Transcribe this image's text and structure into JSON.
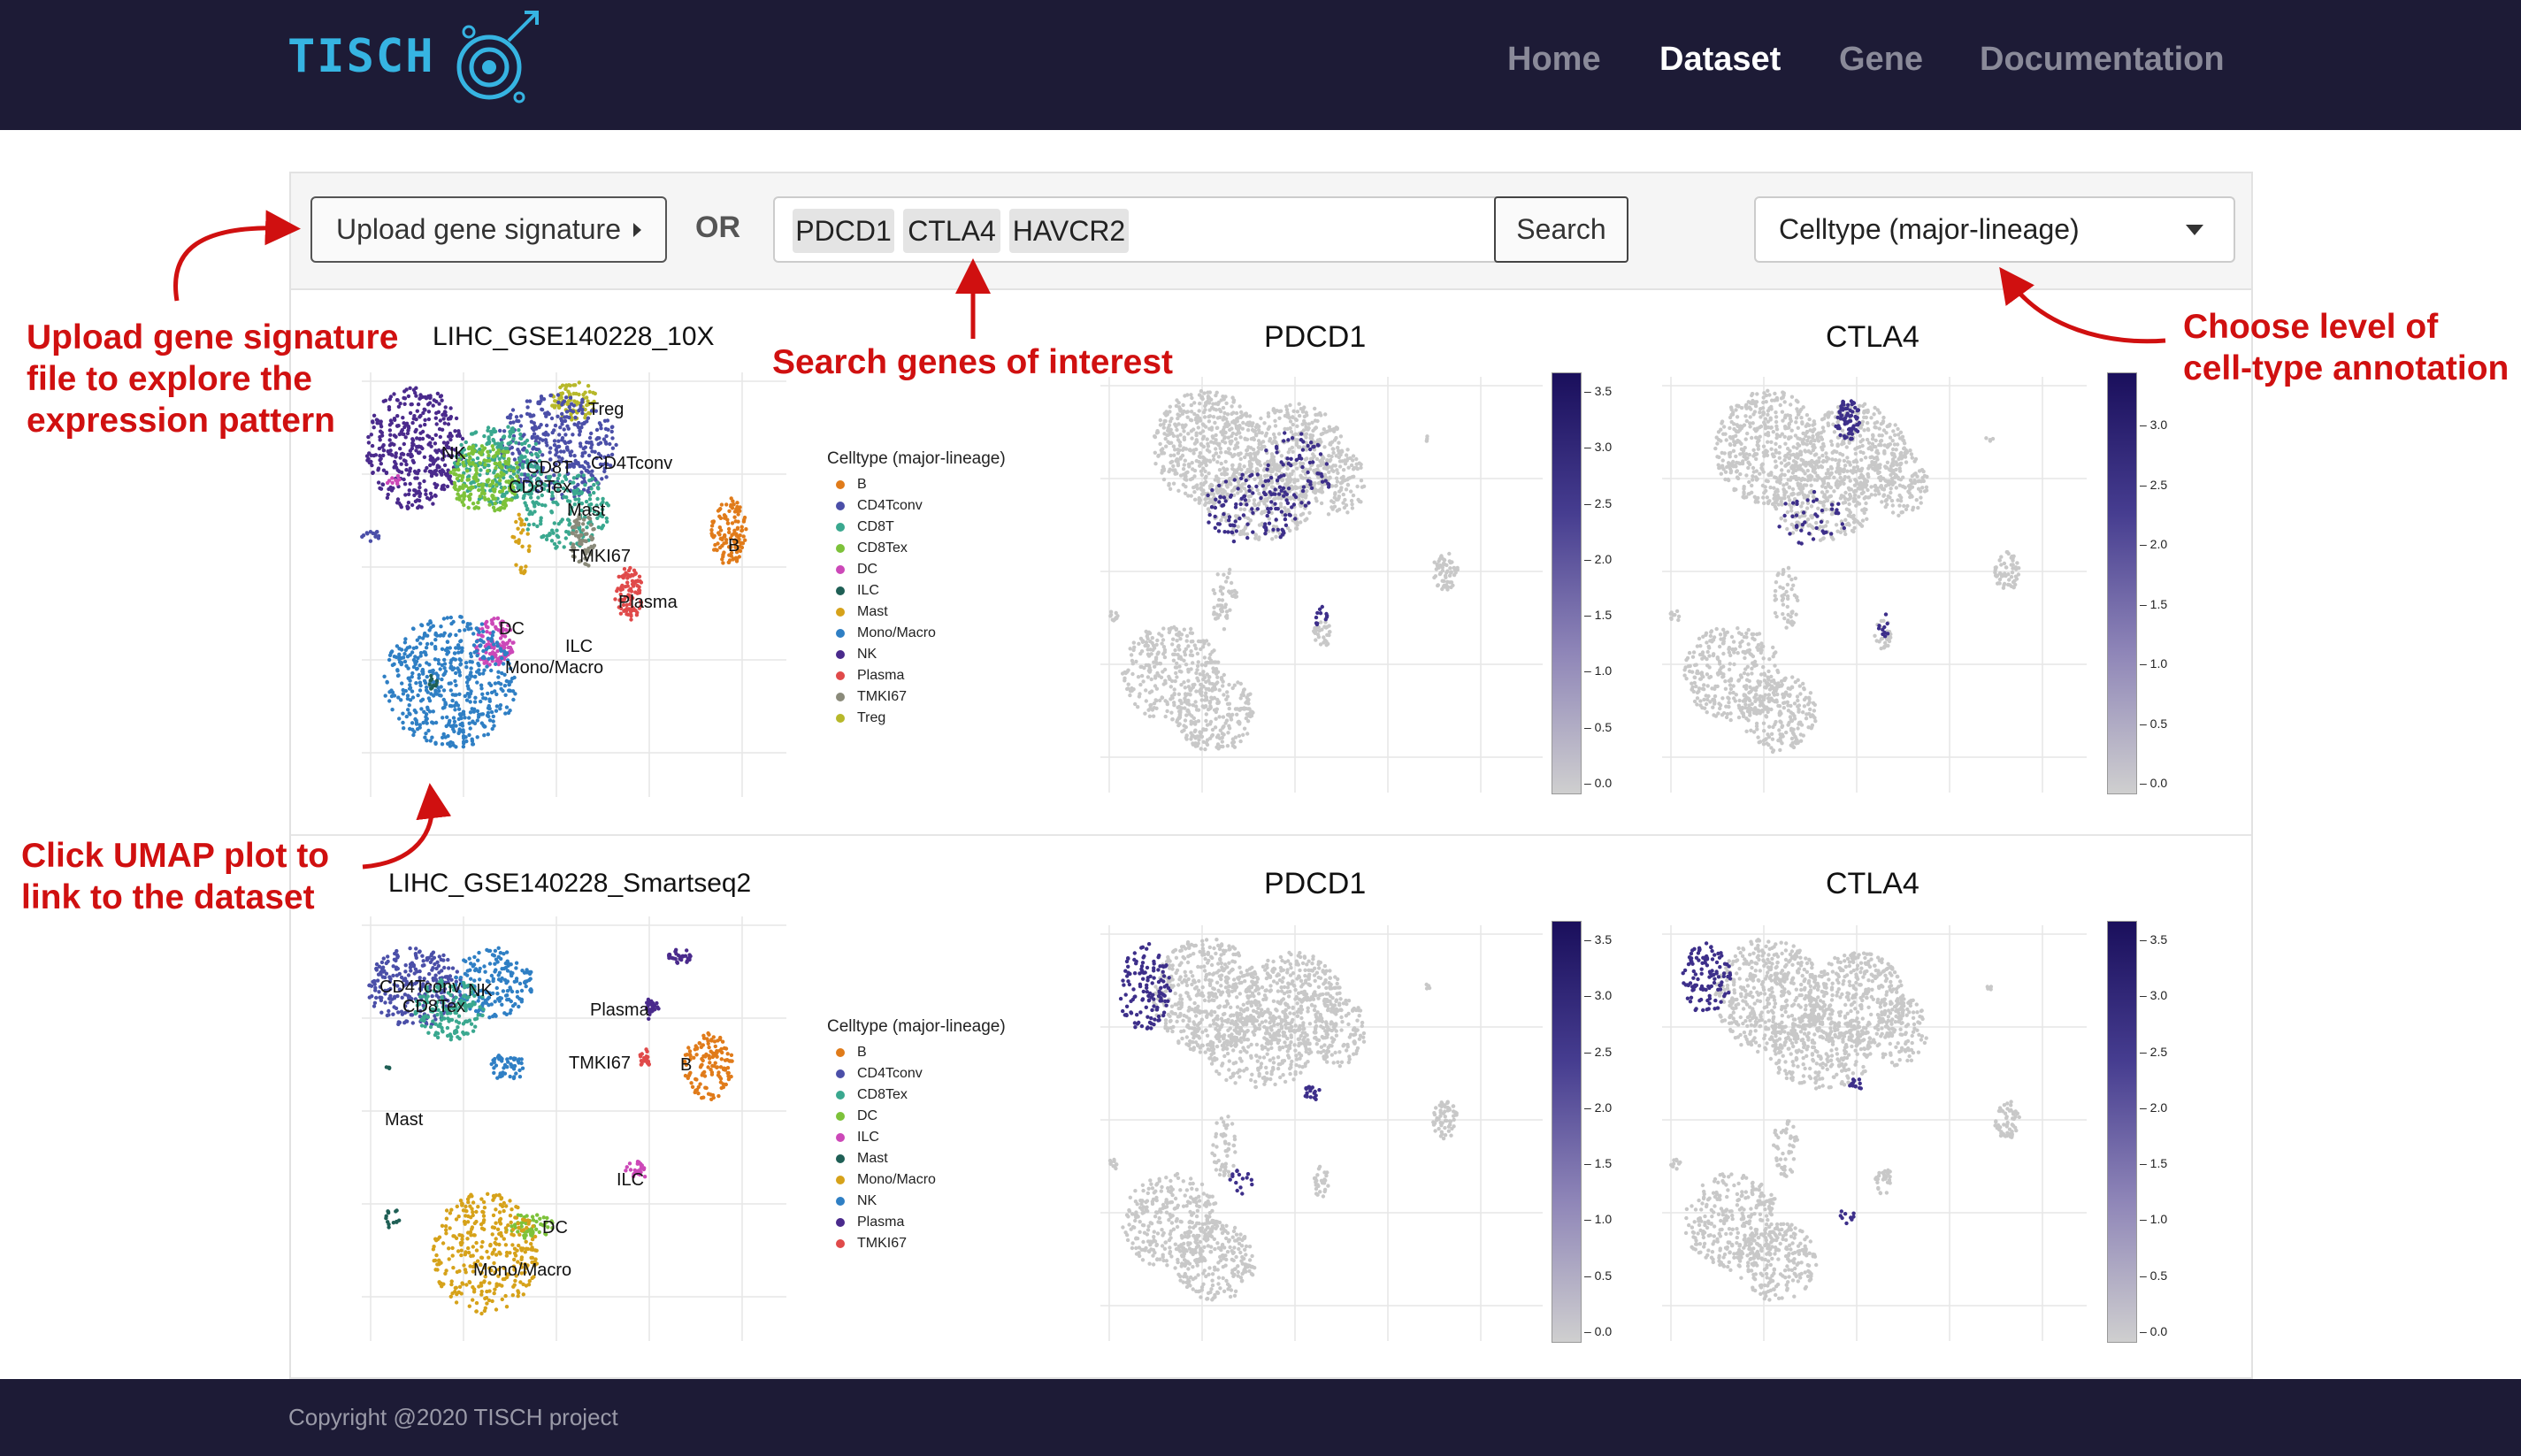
{
  "brand": {
    "name": "TISCH"
  },
  "nav": {
    "items": [
      "Home",
      "Dataset",
      "Gene",
      "Documentation"
    ],
    "active": "Dataset"
  },
  "toolbar": {
    "upload_label": "Upload gene signature",
    "or_label": "OR",
    "search_genes": [
      "PDCD1",
      "CTLA4",
      "HAVCR2"
    ],
    "search_button": "Search",
    "celltype_select": "Celltype (major-lineage)"
  },
  "colors": {
    "navbar": "#1d1b36",
    "annotation": "#d01010",
    "logo": "#36b4e2",
    "expression_high": "#1a0f5c",
    "expression_low": "#cfcfcf"
  },
  "datasets": [
    {
      "title": "LIHC_GSE140228_10X",
      "legend_title": "Celltype (major-lineage)",
      "legend": [
        {
          "name": "B",
          "color": "#e07b1a"
        },
        {
          "name": "CD4Tconv",
          "color": "#4b4fa8"
        },
        {
          "name": "CD8T",
          "color": "#3aa88f"
        },
        {
          "name": "CD8Tex",
          "color": "#7dc23a"
        },
        {
          "name": "DC",
          "color": "#cc48b8"
        },
        {
          "name": "ILC",
          "color": "#1f5f55"
        },
        {
          "name": "Mast",
          "color": "#d6a21a"
        },
        {
          "name": "Mono/Macro",
          "color": "#2f7fc4"
        },
        {
          "name": "NK",
          "color": "#4a2a8c"
        },
        {
          "name": "Plasma",
          "color": "#e04a4a"
        },
        {
          "name": "TMKI67",
          "color": "#8a8a7a"
        },
        {
          "name": "Treg",
          "color": "#b7b82a"
        }
      ],
      "umap_labels": [
        "Treg",
        "NK",
        "CD8T",
        "CD8Tex",
        "CD4Tconv",
        "Mast",
        "B",
        "TMKI67",
        "Plasma",
        "DC",
        "ILC",
        "Mono/Macro"
      ],
      "genes": [
        {
          "name": "PDCD1",
          "colorbar_ticks": [
            "3.5",
            "3.0",
            "2.5",
            "2.0",
            "1.5",
            "1.0",
            "0.5",
            "0.0"
          ]
        },
        {
          "name": "CTLA4",
          "colorbar_ticks": [
            "3.0",
            "2.5",
            "2.0",
            "1.5",
            "1.0",
            "0.5",
            "0.0"
          ]
        }
      ]
    },
    {
      "title": "LIHC_GSE140228_Smartseq2",
      "legend_title": "Celltype (major-lineage)",
      "legend": [
        {
          "name": "B",
          "color": "#e07b1a"
        },
        {
          "name": "CD4Tconv",
          "color": "#4b4fa8"
        },
        {
          "name": "CD8Tex",
          "color": "#3aa88f"
        },
        {
          "name": "DC",
          "color": "#7dc23a"
        },
        {
          "name": "ILC",
          "color": "#cc48b8"
        },
        {
          "name": "Mast",
          "color": "#1f5f55"
        },
        {
          "name": "Mono/Macro",
          "color": "#d6a21a"
        },
        {
          "name": "NK",
          "color": "#2f7fc4"
        },
        {
          "name": "Plasma",
          "color": "#4a2a8c"
        },
        {
          "name": "TMKI67",
          "color": "#e04a4a"
        }
      ],
      "umap_labels": [
        "CD4Tconv",
        "NK",
        "CD8Tex",
        "Plasma",
        "TMKI67",
        "B",
        "Mast",
        "ILC",
        "DC",
        "Mono/Macro"
      ],
      "genes": [
        {
          "name": "PDCD1",
          "colorbar_ticks": [
            "3.5",
            "3.0",
            "2.5",
            "2.0",
            "1.5",
            "1.0",
            "0.5",
            "0.0"
          ]
        },
        {
          "name": "CTLA4",
          "colorbar_ticks": [
            "3.5",
            "3.0",
            "2.5",
            "2.0",
            "1.5",
            "1.0",
            "0.5",
            "0.0"
          ]
        }
      ]
    }
  ],
  "annotations": {
    "upload": [
      "Upload gene signature",
      "file to explore the",
      "expression pattern"
    ],
    "search": "Search genes of interest",
    "level": [
      "Choose level of",
      "cell-type annotation"
    ],
    "click": [
      "Click UMAP plot to",
      "link to the dataset"
    ]
  },
  "footer": {
    "text": "Copyright @2020 TISCH project"
  }
}
